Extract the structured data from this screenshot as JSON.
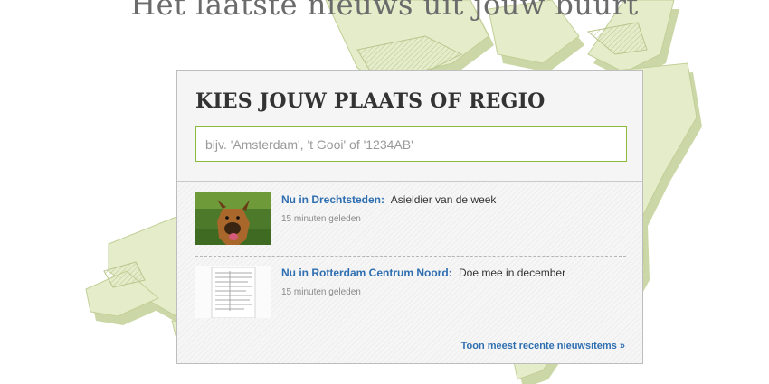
{
  "header": {
    "headline": "Het laatste nieuws uit jouw buurt"
  },
  "panel": {
    "title": "KIES JOUW PLAATS OF REGIO",
    "search_placeholder": "bijv. 'Amsterdam', 't Gooi' of '1234AB'"
  },
  "news": [
    {
      "region": "Nu in Drechtsteden:",
      "headline": "Asieldier van de week",
      "time": "15 minuten geleden",
      "thumbnail": "dog-photo"
    },
    {
      "region": "Nu in Rotterdam Centrum Noord:",
      "headline": "Doe mee in december",
      "time": "15 minuten geleden",
      "thumbnail": "document-photo"
    }
  ],
  "more_link": "Toon meest recente nieuwsitems »",
  "colors": {
    "map": "#e4ecc9",
    "map_edge": "#c9d6a2",
    "link": "#2f6fb1",
    "input_border": "#8cba3c"
  }
}
